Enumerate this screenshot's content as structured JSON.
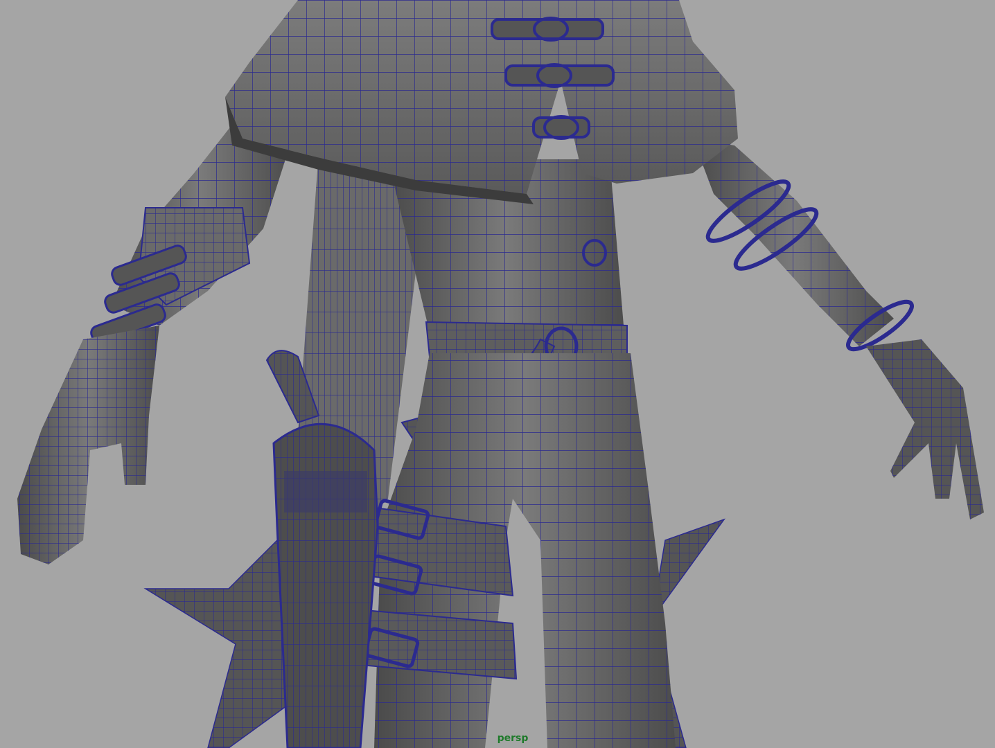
{
  "viewport": {
    "camera_label": "persp",
    "background_color": "#a5a5a5",
    "wireframe_color": "#2b2a8f",
    "shaded_color": "#5e5e5e",
    "label_color": "#1e7a2a",
    "display_mode": "wireframe-on-shaded"
  }
}
